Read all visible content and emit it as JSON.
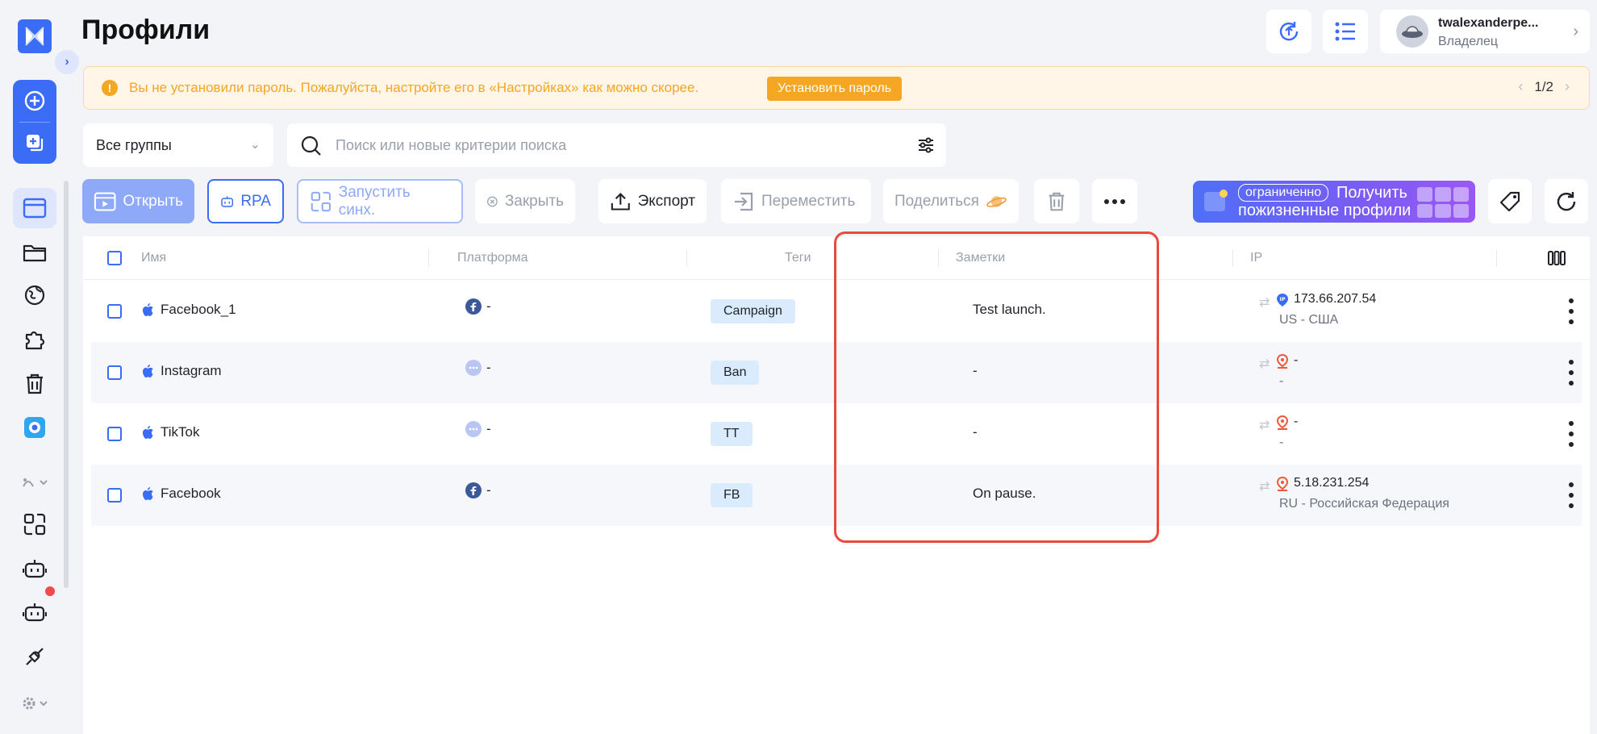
{
  "page": {
    "title": "Профили"
  },
  "user": {
    "name": "twalexanderpe...",
    "role": "Владелец"
  },
  "banner": {
    "text": "Вы не установили пароль. Пожалуйста, настройте его в «Настройках» как можно скорее.",
    "button": "Установить пароль",
    "pager": "1/2"
  },
  "filters": {
    "group": "Все группы",
    "search_placeholder": "Поиск или новые критерии поиска"
  },
  "toolbar": {
    "open": "Открыть",
    "rpa": "RPA",
    "sync": "Запустить синх.",
    "close": "Закрыть",
    "export": "Экспорт",
    "move": "Переместить",
    "share": "Поделиться",
    "promo_tag": "ограниченно",
    "promo_line1": "Получить",
    "promo_line2": "пожизненные профили"
  },
  "table": {
    "headers": {
      "name": "Имя",
      "platform": "Платформа",
      "tags": "Теги",
      "notes": "Заметки",
      "ip": "IP"
    },
    "rows": [
      {
        "name": "Facebook_1",
        "platform_icon": "facebook-icon",
        "platform": "-",
        "tag": "Campaign",
        "note": "Test launch.",
        "ip": "173.66.207.54",
        "location": "US - США",
        "ip_icon": "ip-badge-icon"
      },
      {
        "name": "Instagram",
        "platform_icon": "more-circle-icon",
        "platform": "-",
        "tag": "Ban",
        "note": "-",
        "ip": "-",
        "location": "-",
        "ip_icon": "location-pin-icon"
      },
      {
        "name": "TikTok",
        "platform_icon": "more-circle-icon",
        "platform": "-",
        "tag": "TT",
        "note": "-",
        "ip": "-",
        "location": "-",
        "ip_icon": "location-pin-icon"
      },
      {
        "name": "Facebook",
        "platform_icon": "facebook-icon",
        "platform": "-",
        "tag": "FB",
        "note": "On pause.",
        "ip": "5.18.231.254",
        "location": "RU - Российская Федерация",
        "ip_icon": "location-pin-icon"
      }
    ]
  },
  "colors": {
    "accent": "#3b6cf6",
    "warning": "#f5a623",
    "highlight": "#e84a3b",
    "tag_bg": "#d9ebfd"
  }
}
